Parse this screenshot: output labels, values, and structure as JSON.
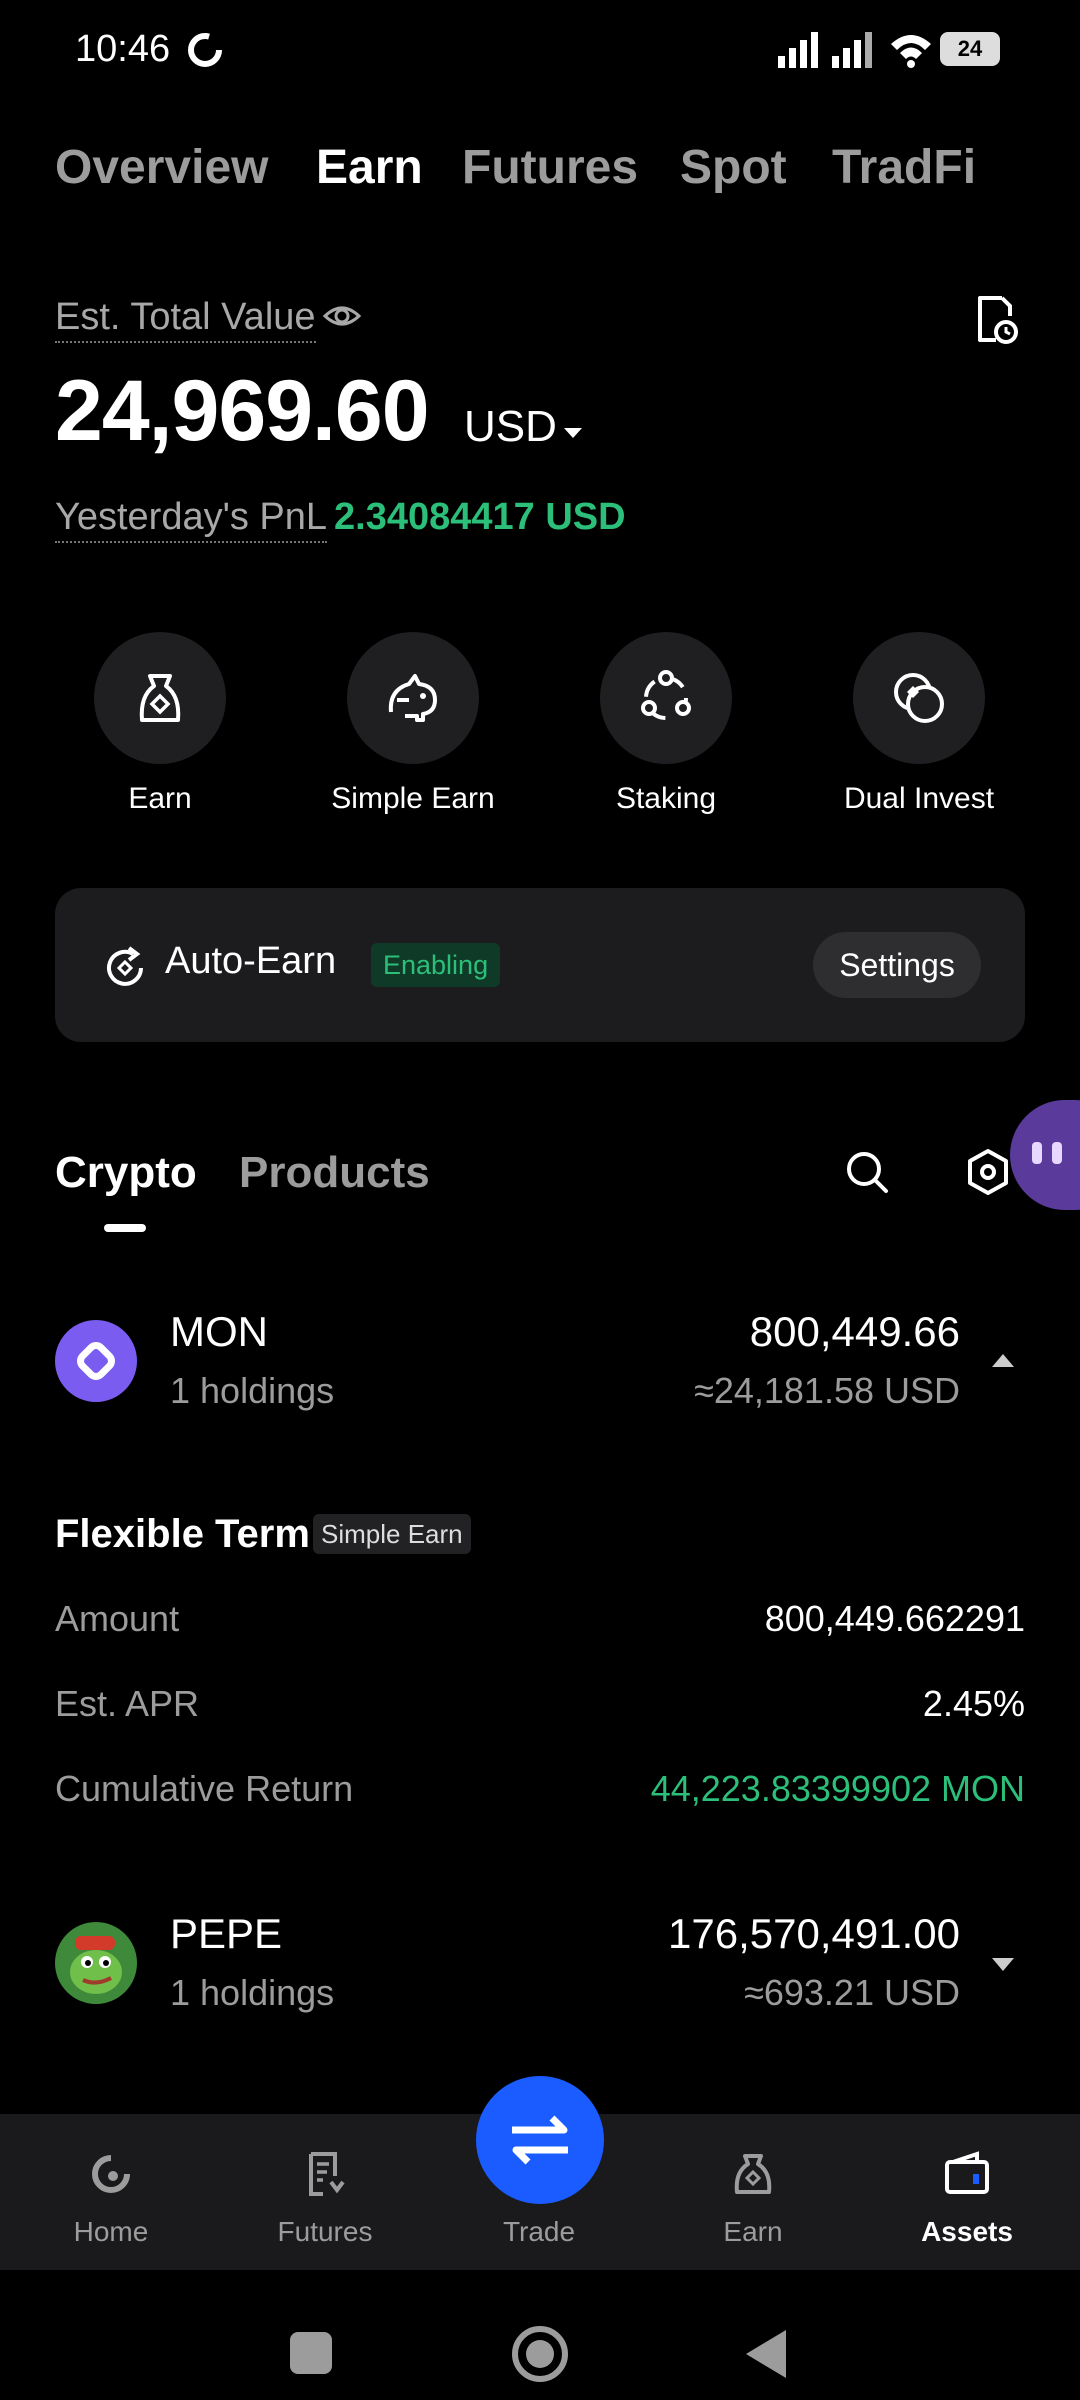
{
  "status": {
    "time": "10:46",
    "battery": "24"
  },
  "top_tabs": [
    {
      "label": "Overview"
    },
    {
      "label": "Earn"
    },
    {
      "label": "Futures"
    },
    {
      "label": "Spot"
    },
    {
      "label": "TradFi"
    }
  ],
  "summary": {
    "est_label": "Est. Total Value",
    "total_value": "24,969.60",
    "currency": "USD",
    "pnl_label": "Yesterday's PnL",
    "pnl_value": "2.34084417 USD"
  },
  "quick_actions": [
    {
      "label": "Earn",
      "icon": "earn-bag-icon"
    },
    {
      "label": "Simple Earn",
      "icon": "piggy-bank-icon"
    },
    {
      "label": "Staking",
      "icon": "staking-nodes-icon"
    },
    {
      "label": "Dual Invest",
      "icon": "coins-icon"
    }
  ],
  "auto_earn": {
    "title": "Auto-Earn",
    "badge": "Enabling",
    "settings": "Settings"
  },
  "asset_tabs": [
    {
      "label": "Crypto"
    },
    {
      "label": "Products"
    }
  ],
  "assets": [
    {
      "name": "MON",
      "holdings": "1 holdings",
      "amount": "800,449.66",
      "usd": "≈24,181.58 USD",
      "expanded": true
    },
    {
      "name": "PEPE",
      "holdings": "1 holdings",
      "amount": "176,570,491.00",
      "usd": "≈693.21 USD",
      "expanded": false
    }
  ],
  "mon_detail": {
    "title": "Flexible Term",
    "badge": "Simple Earn",
    "rows": [
      {
        "label": "Amount",
        "value": "800,449.662291"
      },
      {
        "label": "Est. APR",
        "value": "2.45%"
      },
      {
        "label": "Cumulative Return",
        "value": "44,223.83399902 MON"
      }
    ]
  },
  "bottom_nav": [
    {
      "label": "Home"
    },
    {
      "label": "Futures"
    },
    {
      "label": "Trade"
    },
    {
      "label": "Earn"
    },
    {
      "label": "Assets"
    }
  ],
  "colors": {
    "accent_green": "#2bbf7a",
    "trade_blue": "#1a5cff",
    "mon_purple": "#7b5cf0"
  }
}
